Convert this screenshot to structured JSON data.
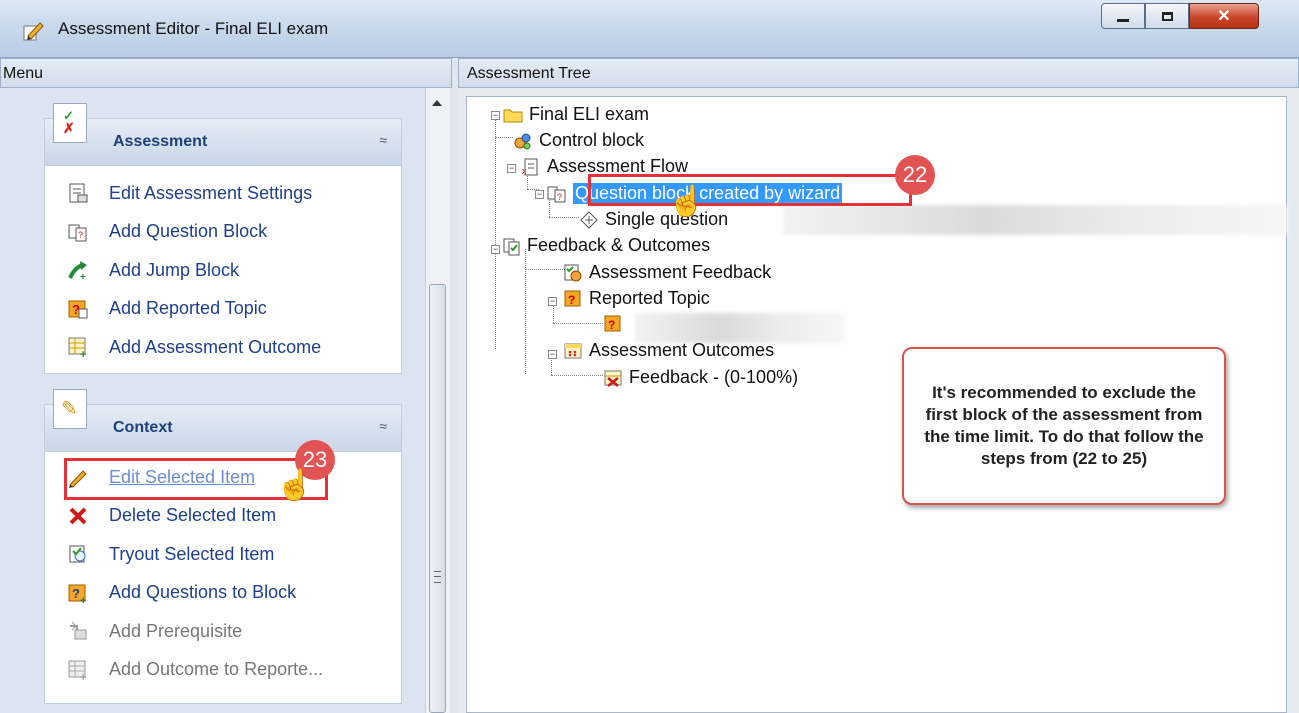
{
  "window": {
    "title": "Assessment Editor - Final ELI exam"
  },
  "menu_pane": {
    "header": "Menu",
    "groups": [
      {
        "title": "Assessment",
        "items": [
          {
            "label": "Edit Assessment Settings",
            "icon": "settings-doc-icon"
          },
          {
            "label": "Add Question Block",
            "icon": "question-block-icon"
          },
          {
            "label": "Add Jump Block",
            "icon": "jump-arrow-icon"
          },
          {
            "label": "Add Reported Topic",
            "icon": "reported-topic-icon"
          },
          {
            "label": "Add Assessment Outcome",
            "icon": "outcome-grid-icon"
          }
        ]
      },
      {
        "title": "Context",
        "items": [
          {
            "label": "Edit Selected Item",
            "icon": "pencil-icon"
          },
          {
            "label": "Delete Selected Item",
            "icon": "red-x-icon"
          },
          {
            "label": "Tryout Selected Item",
            "icon": "tryout-icon"
          },
          {
            "label": "Add Questions to Block",
            "icon": "add-questions-icon"
          },
          {
            "label": "Add Prerequisite",
            "icon": "prerequisite-icon"
          },
          {
            "label": "Add Outcome to Reporte...",
            "icon": "outcome-report-icon"
          }
        ]
      }
    ]
  },
  "tree_pane": {
    "header": "Assessment Tree",
    "nodes": {
      "root": "Final ELI exam",
      "control_block": "Control block",
      "assessment_flow": "Assessment Flow",
      "question_block": "Question block created by wizard",
      "single_question": "Single question",
      "feedback_outcomes": "Feedback & Outcomes",
      "assessment_feedback": "Assessment Feedback",
      "reported_topic": "Reported Topic",
      "assessment_outcomes": "Assessment Outcomes",
      "feedback_range": "Feedback - (0-100%)"
    }
  },
  "annotations": {
    "step_22": "22",
    "step_23": "23",
    "callout": "It's recommended to exclude the first block of the assessment from the time limit. To do that follow the steps from (22 to 25)",
    "accent_color": "#e5323a"
  }
}
